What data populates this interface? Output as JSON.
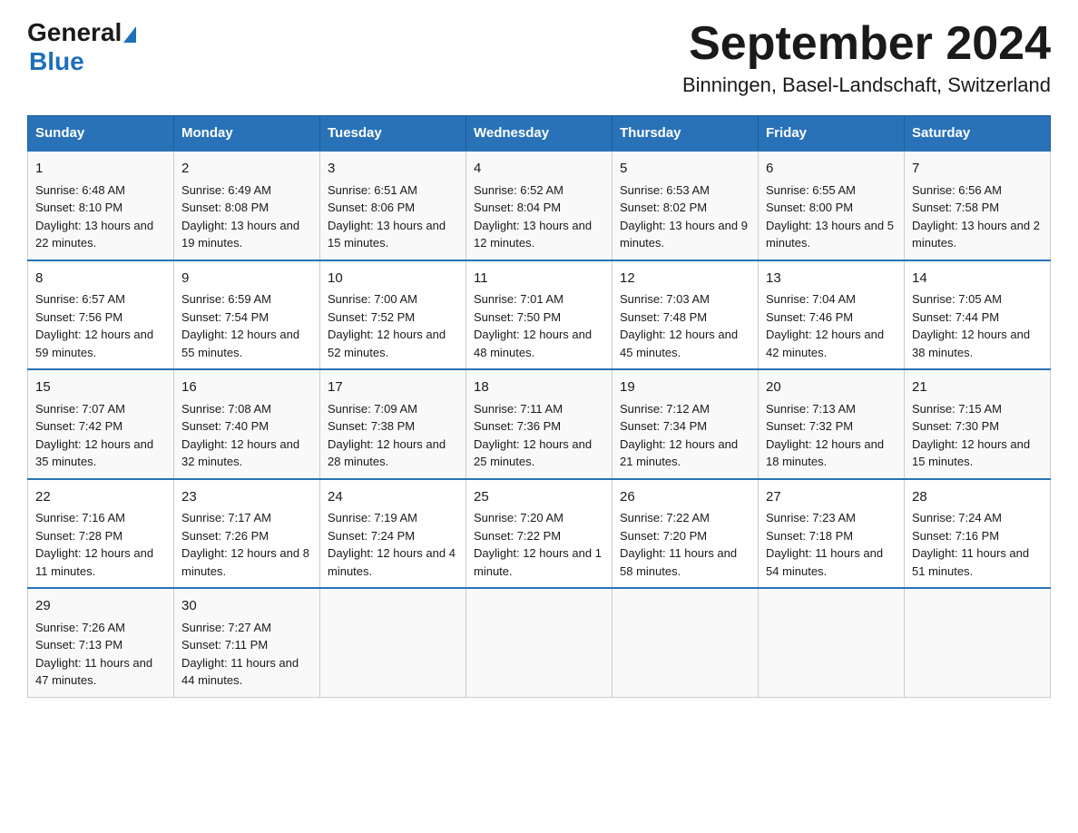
{
  "header": {
    "logo_general": "General",
    "logo_blue": "Blue",
    "month_title": "September 2024",
    "location": "Binningen, Basel-Landschaft, Switzerland"
  },
  "weekdays": [
    "Sunday",
    "Monday",
    "Tuesday",
    "Wednesday",
    "Thursday",
    "Friday",
    "Saturday"
  ],
  "weeks": [
    [
      {
        "day": "1",
        "sunrise": "6:48 AM",
        "sunset": "8:10 PM",
        "daylight": "13 hours and 22 minutes."
      },
      {
        "day": "2",
        "sunrise": "6:49 AM",
        "sunset": "8:08 PM",
        "daylight": "13 hours and 19 minutes."
      },
      {
        "day": "3",
        "sunrise": "6:51 AM",
        "sunset": "8:06 PM",
        "daylight": "13 hours and 15 minutes."
      },
      {
        "day": "4",
        "sunrise": "6:52 AM",
        "sunset": "8:04 PM",
        "daylight": "13 hours and 12 minutes."
      },
      {
        "day": "5",
        "sunrise": "6:53 AM",
        "sunset": "8:02 PM",
        "daylight": "13 hours and 9 minutes."
      },
      {
        "day": "6",
        "sunrise": "6:55 AM",
        "sunset": "8:00 PM",
        "daylight": "13 hours and 5 minutes."
      },
      {
        "day": "7",
        "sunrise": "6:56 AM",
        "sunset": "7:58 PM",
        "daylight": "13 hours and 2 minutes."
      }
    ],
    [
      {
        "day": "8",
        "sunrise": "6:57 AM",
        "sunset": "7:56 PM",
        "daylight": "12 hours and 59 minutes."
      },
      {
        "day": "9",
        "sunrise": "6:59 AM",
        "sunset": "7:54 PM",
        "daylight": "12 hours and 55 minutes."
      },
      {
        "day": "10",
        "sunrise": "7:00 AM",
        "sunset": "7:52 PM",
        "daylight": "12 hours and 52 minutes."
      },
      {
        "day": "11",
        "sunrise": "7:01 AM",
        "sunset": "7:50 PM",
        "daylight": "12 hours and 48 minutes."
      },
      {
        "day": "12",
        "sunrise": "7:03 AM",
        "sunset": "7:48 PM",
        "daylight": "12 hours and 45 minutes."
      },
      {
        "day": "13",
        "sunrise": "7:04 AM",
        "sunset": "7:46 PM",
        "daylight": "12 hours and 42 minutes."
      },
      {
        "day": "14",
        "sunrise": "7:05 AM",
        "sunset": "7:44 PM",
        "daylight": "12 hours and 38 minutes."
      }
    ],
    [
      {
        "day": "15",
        "sunrise": "7:07 AM",
        "sunset": "7:42 PM",
        "daylight": "12 hours and 35 minutes."
      },
      {
        "day": "16",
        "sunrise": "7:08 AM",
        "sunset": "7:40 PM",
        "daylight": "12 hours and 32 minutes."
      },
      {
        "day": "17",
        "sunrise": "7:09 AM",
        "sunset": "7:38 PM",
        "daylight": "12 hours and 28 minutes."
      },
      {
        "day": "18",
        "sunrise": "7:11 AM",
        "sunset": "7:36 PM",
        "daylight": "12 hours and 25 minutes."
      },
      {
        "day": "19",
        "sunrise": "7:12 AM",
        "sunset": "7:34 PM",
        "daylight": "12 hours and 21 minutes."
      },
      {
        "day": "20",
        "sunrise": "7:13 AM",
        "sunset": "7:32 PM",
        "daylight": "12 hours and 18 minutes."
      },
      {
        "day": "21",
        "sunrise": "7:15 AM",
        "sunset": "7:30 PM",
        "daylight": "12 hours and 15 minutes."
      }
    ],
    [
      {
        "day": "22",
        "sunrise": "7:16 AM",
        "sunset": "7:28 PM",
        "daylight": "12 hours and 11 minutes."
      },
      {
        "day": "23",
        "sunrise": "7:17 AM",
        "sunset": "7:26 PM",
        "daylight": "12 hours and 8 minutes."
      },
      {
        "day": "24",
        "sunrise": "7:19 AM",
        "sunset": "7:24 PM",
        "daylight": "12 hours and 4 minutes."
      },
      {
        "day": "25",
        "sunrise": "7:20 AM",
        "sunset": "7:22 PM",
        "daylight": "12 hours and 1 minute."
      },
      {
        "day": "26",
        "sunrise": "7:22 AM",
        "sunset": "7:20 PM",
        "daylight": "11 hours and 58 minutes."
      },
      {
        "day": "27",
        "sunrise": "7:23 AM",
        "sunset": "7:18 PM",
        "daylight": "11 hours and 54 minutes."
      },
      {
        "day": "28",
        "sunrise": "7:24 AM",
        "sunset": "7:16 PM",
        "daylight": "11 hours and 51 minutes."
      }
    ],
    [
      {
        "day": "29",
        "sunrise": "7:26 AM",
        "sunset": "7:13 PM",
        "daylight": "11 hours and 47 minutes."
      },
      {
        "day": "30",
        "sunrise": "7:27 AM",
        "sunset": "7:11 PM",
        "daylight": "11 hours and 44 minutes."
      },
      null,
      null,
      null,
      null,
      null
    ]
  ],
  "labels": {
    "sunrise": "Sunrise:",
    "sunset": "Sunset:",
    "daylight": "Daylight:"
  }
}
